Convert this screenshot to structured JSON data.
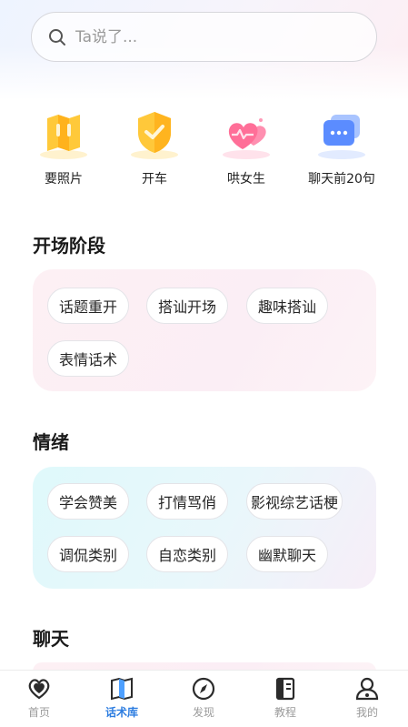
{
  "search": {
    "placeholder": "Ta说了..."
  },
  "quick_actions": [
    {
      "label": "要照片",
      "icon": "map-icon"
    },
    {
      "label": "开车",
      "icon": "shield-check-icon"
    },
    {
      "label": "哄女生",
      "icon": "hearts-icon"
    },
    {
      "label": "聊天前20句",
      "icon": "chat-bubble-icon"
    }
  ],
  "sections": [
    {
      "title": "开场阶段",
      "chips": [
        "话题重开",
        "搭讪开场",
        "趣味搭讪",
        "表情话术"
      ]
    },
    {
      "title": "情绪",
      "chips": [
        "学会赞美",
        "打情骂俏",
        "影视综艺话梗",
        "调侃类别",
        "自恋类别",
        "幽默聊天"
      ]
    },
    {
      "title": "聊天"
    }
  ],
  "tabs": [
    {
      "label": "首页",
      "icon": "heart-icon"
    },
    {
      "label": "话术库",
      "icon": "book-icon",
      "active": true
    },
    {
      "label": "发现",
      "icon": "compass-icon"
    },
    {
      "label": "教程",
      "icon": "tutorial-icon"
    },
    {
      "label": "我的",
      "icon": "person-icon"
    }
  ],
  "colors": {
    "accent": "#2d7de0",
    "tab_inactive": "#9b9b9b"
  }
}
